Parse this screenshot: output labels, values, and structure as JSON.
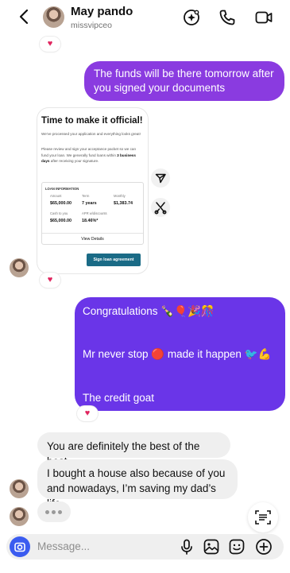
{
  "header": {
    "name": "May pando",
    "username": "missvipceo"
  },
  "messages": {
    "out1": "The funds will be there tomorrow after you signed your documents",
    "out2_line1": "Congratulations",
    "out2_line1_emoji": "🍾🎈🎉🎊",
    "out2_line2": "Mr never stop",
    "out2_line2_mid_emoji": "🔴",
    "out2_line2_end": "made it happen",
    "out2_line2_end_emoji": "🐦💪",
    "out2_line3": "The credit goat",
    "in1": "You are definitely the best of the best",
    "in2": "I bought a house also because of you and nowadays, I’m saving my dad’s life",
    "reaction": "♥"
  },
  "card": {
    "title": "Time to make it official!",
    "para1": "We've processed your application and everything looks great!",
    "para2_a": "Please review and sign your acceptance packet so we can fund your loan. We generally fund loans within ",
    "para2_b": "3 business days",
    "para2_c": " after receiving your signature.",
    "loan_info_label": "LOAN INFORMATION",
    "amount_label": "Amount",
    "amount_value": "$65,000.00",
    "term_label": "Term",
    "term_value": "7 years",
    "monthly_label": "Monthly",
    "monthly_value": "$1,383.74",
    "cash_label": "Cash to you",
    "cash_value": "$65,000.00",
    "apr_label": "APR w/discounts",
    "apr_value": "18.46%*",
    "view_details": "View Details",
    "sign_button": "Sign loan agreement"
  },
  "composer": {
    "placeholder": "Message..."
  },
  "colors": {
    "bubble_purple": "#8a3be0",
    "bubble_violet": "#6a35e8",
    "camera_blue": "#3b5cf0",
    "sign_button": "#1a6b86",
    "heart": "#e0245e"
  },
  "icons": [
    "back-arrow-icon",
    "ai-sparkle-icon",
    "phone-icon",
    "video-camera-icon",
    "share-icon",
    "remix-icon",
    "camera-icon",
    "microphone-icon",
    "image-icon",
    "sticker-icon",
    "plus-icon",
    "scan-text-icon"
  ]
}
